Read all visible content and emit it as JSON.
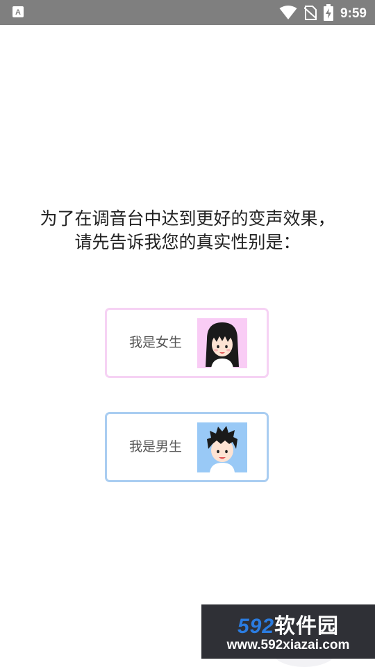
{
  "status_bar": {
    "time": "9:59",
    "icons": [
      "app-notification-icon",
      "wifi-icon",
      "no-sim-icon",
      "battery-charging-icon"
    ]
  },
  "prompt": {
    "line1": "为了在调音台中达到更好的变声效果，",
    "line2": "请先告诉我您的真实性别是："
  },
  "options": {
    "female": {
      "label": "我是女生",
      "border_color": "#f6d2f4",
      "avatar_bg": "#f9ccf5"
    },
    "male": {
      "label": "我是男生",
      "border_color": "#a9cdf1",
      "avatar_bg": "#99c9f6"
    }
  },
  "watermark": {
    "brand_number": "592",
    "brand_text": "软件园",
    "url": "www.592xiazai.com"
  }
}
